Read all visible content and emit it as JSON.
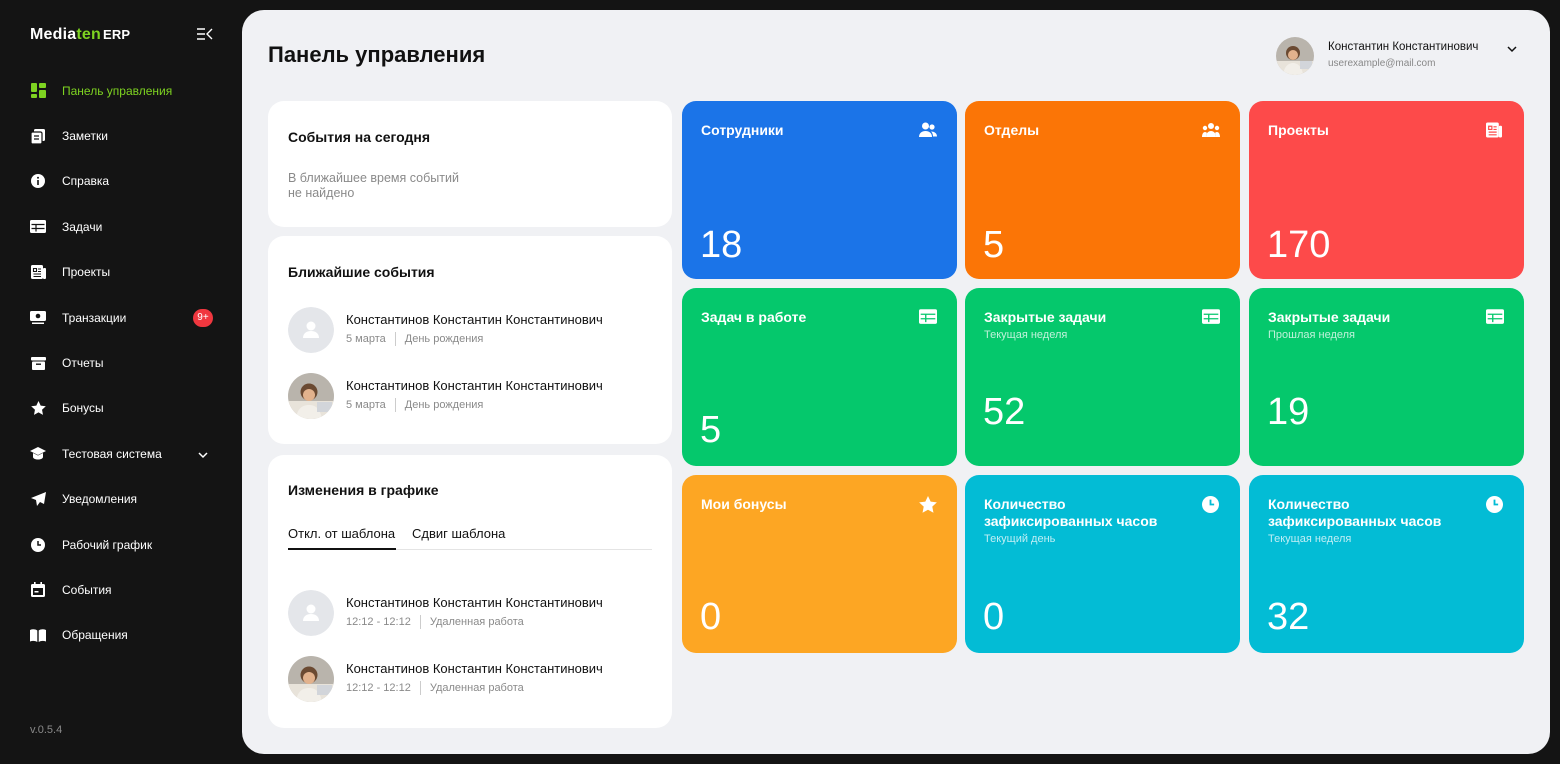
{
  "sidebar": {
    "logo": {
      "part1": "Media",
      "part2": "ten",
      "part3": "ERP"
    },
    "items": [
      {
        "label": "Панель управления",
        "icon": "dashboard-icon"
      },
      {
        "label": "Заметки",
        "icon": "notes-icon"
      },
      {
        "label": "Справка",
        "icon": "info-icon"
      },
      {
        "label": "Задачи",
        "icon": "table-icon"
      },
      {
        "label": "Проекты",
        "icon": "projects-icon"
      },
      {
        "label": "Транзакции",
        "icon": "transactions-icon",
        "badge": "9+"
      },
      {
        "label": "Отчеты",
        "icon": "reports-icon"
      },
      {
        "label": "Бонусы",
        "icon": "star-icon"
      },
      {
        "label": "Тестовая система",
        "icon": "graduation-cap-icon"
      },
      {
        "label": "Уведомления",
        "icon": "paper-plane-icon"
      },
      {
        "label": "Рабочий график",
        "icon": "clock-icon"
      },
      {
        "label": "События",
        "icon": "calendar-icon"
      },
      {
        "label": "Обращения",
        "icon": "book-icon"
      }
    ],
    "version": "v.0.5.4"
  },
  "header": {
    "title": "Панель управления",
    "user": {
      "name": "Константин Константинович",
      "email": "userexample@mail.com"
    }
  },
  "events_today": {
    "title": "События на сегодня",
    "empty_line1": "В ближайшее время событий",
    "empty_line2": "не найдено"
  },
  "upcoming": {
    "title": "Ближайшие события",
    "items": [
      {
        "name": "Константинов Константин Константинович",
        "date": "5 марта",
        "type": "День рождения"
      },
      {
        "name": "Константинов Константин Константинович",
        "date": "5 марта",
        "type": "День рождения"
      }
    ]
  },
  "schedule": {
    "title": "Изменения в графике",
    "tabs": [
      "Откл. от шаблона",
      "Сдвиг шаблона"
    ],
    "items": [
      {
        "name": "Константинов Константин Константинович",
        "time": "12:12 - 12:12",
        "type": "Удаленная работа"
      },
      {
        "name": "Константинов Константин Константинович",
        "time": "12:12 - 12:12",
        "type": "Удаленная работа"
      }
    ]
  },
  "tiles": [
    {
      "title": "Сотрудники",
      "value": "18",
      "color": "#1b74e8",
      "icon": "users-icon"
    },
    {
      "title": "Отделы",
      "value": "5",
      "color": "#fb7506",
      "icon": "group-icon"
    },
    {
      "title": "Проекты",
      "value": "170",
      "color": "#fd4a4a",
      "icon": "projects-icon"
    },
    {
      "title": "Задач в работе",
      "value": "5",
      "color": "#05c86c",
      "icon": "table-icon"
    },
    {
      "title": "Закрытые задачи",
      "subtitle": "Текущая неделя",
      "value": "52",
      "color": "#05c86c",
      "icon": "table-icon"
    },
    {
      "title": "Закрытые задачи",
      "subtitle": "Прошлая неделя",
      "value": "19",
      "color": "#05c86c",
      "icon": "table-icon"
    },
    {
      "title": "Мои бонусы",
      "value": "0",
      "color": "#fda623",
      "icon": "star-icon"
    },
    {
      "title": "Количество зафиксированных часов",
      "subtitle": "Текущий день",
      "value": "0",
      "color": "#03bcd5",
      "icon": "clock-icon"
    },
    {
      "title": "Количество зафиксированных часов",
      "subtitle": "Текущая неделя",
      "value": "32",
      "color": "#03bcd5",
      "icon": "clock-icon"
    }
  ]
}
